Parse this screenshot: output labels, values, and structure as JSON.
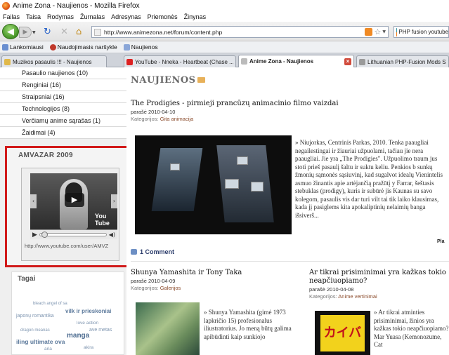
{
  "window": {
    "title": "Anime Zona - Naujienos - Mozilla Firefox"
  },
  "menu": [
    "Failas",
    "Taisa",
    "Rodymas",
    "Žurnalas",
    "Adresynas",
    "Priemonės",
    "Žinynas"
  ],
  "nav": {
    "back_icon": "back-arrow",
    "forward_icon": "forward-arrow",
    "url": "http://www.animezona.net/forum/content.php",
    "search_value": "PHP fusion youtube"
  },
  "bookmarks": [
    "Lankomiausi",
    "Naudojimasis naršykle",
    "Naujienos"
  ],
  "tabs": [
    {
      "label": "Muzikos pasaulis !!! - Naujienos"
    },
    {
      "label": "YouTube - Nneka - Heartbeat (Chase ..."
    },
    {
      "label": "Anime Zona - Naujienos"
    },
    {
      "label": "Lithuanian PHP-Fusion Mods Support"
    }
  ],
  "sidebar": {
    "links": [
      "Pasaulio naujienos (10)",
      "Renginiai (16)",
      "Straipsniai (16)",
      "Technologijos (8)",
      "Verčiamų anime sąrašas (1)",
      "Žaidimai (4)"
    ],
    "video_panel": {
      "title": "AMVAZAR 2009",
      "url": "http://www.youtube.com/user/AMVZ",
      "logo": "You Tube"
    },
    "tags_panel": {
      "title": "Tagai",
      "tags": [
        "bleach angel of sa",
        "vilk ir prieskoniai",
        "japonų romantika",
        "love action",
        "ave metas",
        "dragon meanas",
        "manga",
        "iling ultimate ova",
        "aria",
        "akira"
      ]
    }
  },
  "main": {
    "heading": "NAUJIENOS",
    "article1": {
      "title": "The Prodigies - pirmieji prancūzų animacinio filmo vaizdai",
      "date": "parašė 2010-04-10",
      "category_label": "Kategorijos:",
      "category": "Gita animacija",
      "text": "» Niujorkas, Centrinis Parkas, 2010. Tenka paaugliai negailestingai ir žiauriai užpuolami, tačiau jie nera paaugliai. Jie yra „The Prodigies\". Užpuolimo traum jus stoti prieš pasaulį šaltu ir suktu keliu. Penkios b sunkų žmonių sąmonės sąsiuvinį, kad sugalvot idealų Vienintelis asmuo žinantis apie artėjančią pražūtį y Farrar, šeštasis stebuklas (prodigy), kuris ir subūrė jis Kaunas su savo kolegom, pasaulis vis dar turi vilt tai tik laiko klausimas, kada jį pasiglems kita apokaliptinių nelaimių banga išsiverš...",
      "comments": "1 Comment",
      "more": "Pla"
    },
    "article2": {
      "title": "Shunya Yamashita ir Tony Taka",
      "date": "parašė 2010-04-09",
      "category_label": "Kategorijos:",
      "category": "Galerijos",
      "text": "» Shunya Yamashita (gimė 1973 lapkričio 15) profesionalus iliustratorius. Jo meną būtų galima apibūdinti kaip sunkiojo"
    },
    "article3": {
      "title": "Ar tikrai prisiminimai yra kažkas tokio neapčiuopiamo?",
      "date": "parašė 2010-04-08",
      "category_label": "Kategorijos:",
      "category": "Anime vertinimai",
      "text": "» Ar tikrai atminties prisiminimai, žinios yra kažkas tokio neapčiuopiamo? Mar Yuasa (Kemonozume, Cat",
      "thumb_text": "カイバ"
    }
  }
}
